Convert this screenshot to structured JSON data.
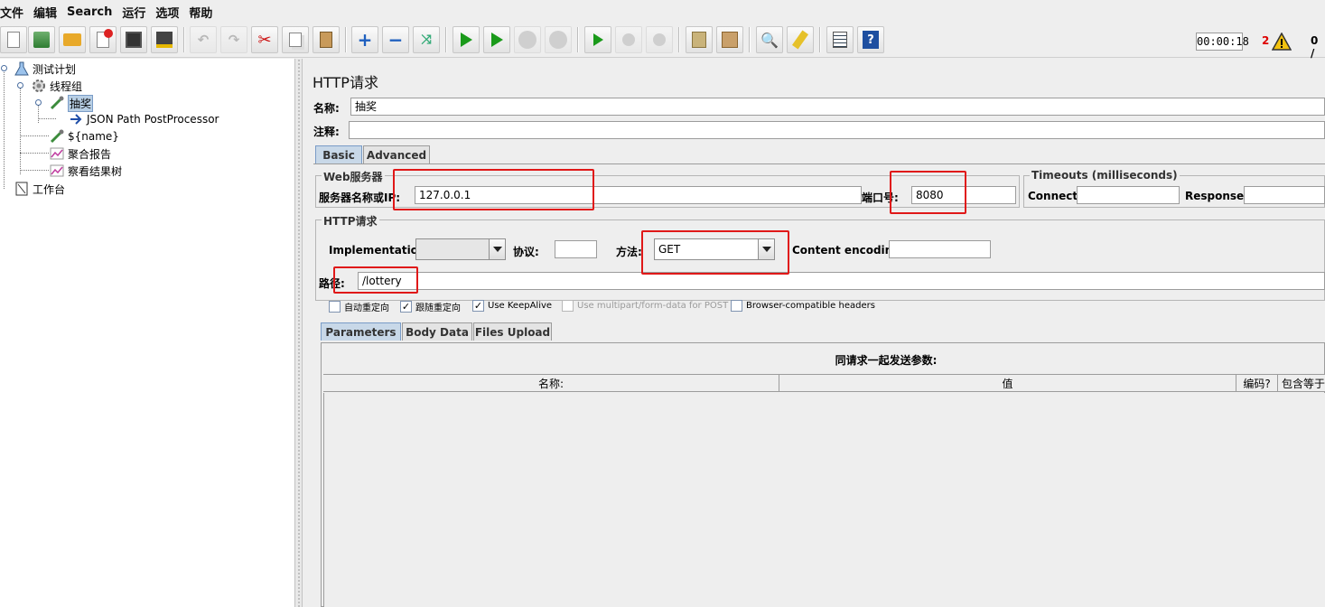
{
  "menu": [
    "文件",
    "编辑",
    "Search",
    "运行",
    "选项",
    "帮助"
  ],
  "toolbar": {
    "buttons": [
      "new-icon",
      "templates-icon",
      "open-icon",
      "close-icon",
      "save-icon",
      "save-as-icon",
      "undo-icon",
      "redo-icon",
      "cut-icon",
      "copy-icon",
      "paste-icon",
      "expand-icon",
      "collapse-icon",
      "toggle-icon",
      "start-icon",
      "start-no-pauses-icon",
      "stop-icon",
      "shutdown-icon",
      "remote-start-icon",
      "remote-stop-icon",
      "remote-shutdown-icon",
      "clear-icon",
      "clear-all-icon",
      "search-icon",
      "reset-search-icon",
      "function-helper-icon",
      "help-icon"
    ],
    "timer": "00:00:18",
    "warning_count": "2",
    "threads": "0 /"
  },
  "tree": {
    "test_plan": "测试计划",
    "thread_group": "线程组",
    "sampler": "抽奖",
    "postprocessor": "JSON Path PostProcessor",
    "variable": "${name}",
    "aggregate_report": "聚合报告",
    "results_tree": "察看结果树",
    "workbench": "工作台"
  },
  "panel": {
    "title": "HTTP请求",
    "name_label": "名称:",
    "name_value": "抽奖",
    "comment_label": "注释:",
    "comment_value": "",
    "tabs": [
      "Basic",
      "Advanced"
    ],
    "web_server": {
      "title": "Web服务器",
      "server_label": "服务器名称或IP:",
      "server_value": "127.0.0.1",
      "port_label": "端口号:",
      "port_value": "8080"
    },
    "timeouts": {
      "title": "Timeouts (milliseconds)",
      "connect_label": "Connect:",
      "connect_value": "",
      "response_label": "Response:",
      "response_value": ""
    },
    "http_request": {
      "title": "HTTP请求",
      "implementation_label": "Implementation:",
      "implementation_value": "",
      "protocol_label": "协议:",
      "protocol_value": "",
      "method_label": "方法:",
      "method_value": "GET",
      "encoding_label": "Content encoding:",
      "encoding_value": "",
      "path_label": "路径:",
      "path_value": "/lottery"
    },
    "checkboxes": [
      {
        "label": "自动重定向",
        "checked": false,
        "enabled": true
      },
      {
        "label": "跟随重定向",
        "checked": true,
        "enabled": true
      },
      {
        "label": "Use KeepAlive",
        "checked": true,
        "enabled": true
      },
      {
        "label": "Use multipart/form-data for POST",
        "checked": false,
        "enabled": false
      },
      {
        "label": "Browser-compatible headers",
        "checked": false,
        "enabled": true
      }
    ],
    "subtabs": [
      "Parameters",
      "Body Data",
      "Files Upload"
    ],
    "params_title": "同请求一起发送参数:",
    "columns": [
      "名称:",
      "值",
      "编码?",
      "包含等于?"
    ]
  },
  "colors": {
    "highlight_box": "#e01818",
    "selection": "#b8cfe5"
  }
}
